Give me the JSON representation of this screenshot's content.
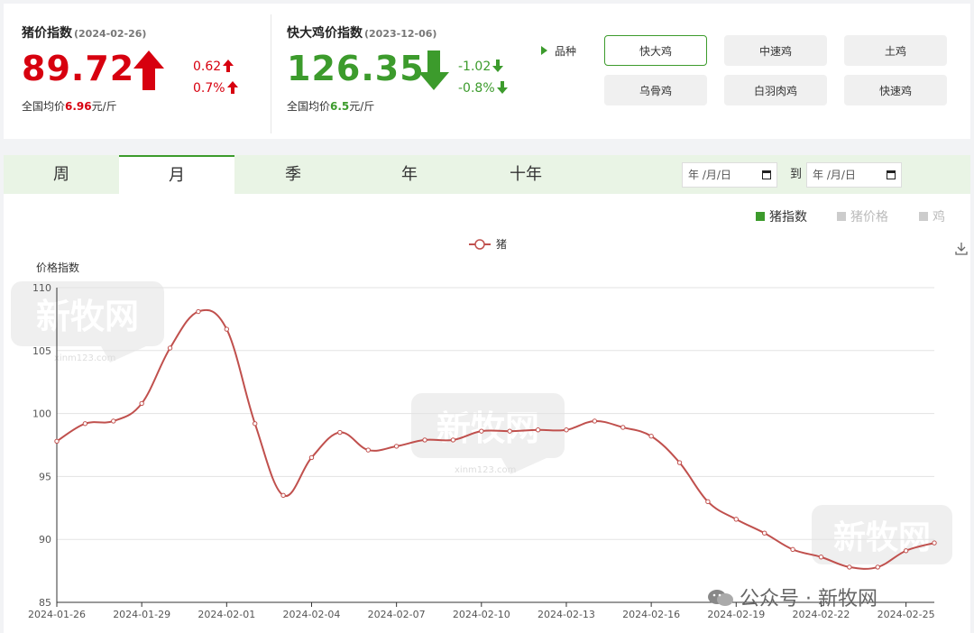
{
  "pig_index": {
    "title": "猪价指数",
    "date": "(2024-02-26)",
    "value": "89.72",
    "change_abs": "0.62",
    "change_pct": "0.7%",
    "avg_prefix": "全国均价",
    "avg_value": "6.96",
    "avg_unit": "元/斤"
  },
  "chicken_index": {
    "title": "快大鸡价指数",
    "date": "(2023-12-06)",
    "value": "126.35",
    "change_abs": "-1.02",
    "change_pct": "-0.8%",
    "avg_prefix": "全国均价",
    "avg_value": "6.5",
    "avg_unit": "元/斤"
  },
  "variety": {
    "label": "品种",
    "options": [
      "快大鸡",
      "中速鸡",
      "土鸡",
      "乌骨鸡",
      "白羽肉鸡",
      "快速鸡"
    ],
    "selected": "快大鸡"
  },
  "period_tabs": [
    "周",
    "月",
    "季",
    "年",
    "十年"
  ],
  "period_selected": "月",
  "date_range": {
    "from_placeholder": "年 /月/日",
    "to_label": "到",
    "to_placeholder": "年 /月/日"
  },
  "series_toggle": [
    {
      "label": "猪指数",
      "active": true,
      "color": "#3c9b2c"
    },
    {
      "label": "猪价格",
      "active": false,
      "color": "#cccccc"
    },
    {
      "label": "鸡",
      "active": false,
      "color": "#cccccc"
    }
  ],
  "watermark": {
    "brand": "新牧网",
    "url": "xinm123.com",
    "footer": "公众号 · 新牧网"
  },
  "icons": {
    "download": "download-icon",
    "wechat": "wechat-icon",
    "up": "arrow-up-icon",
    "down": "arrow-down-icon"
  },
  "colors": {
    "up": "#d7000f",
    "down": "#3c9b2c",
    "line": "#c0504d",
    "accent": "#3c9b2c"
  },
  "chart_data": {
    "type": "line",
    "ylabel": "价格指数",
    "ylim": [
      85,
      110
    ],
    "yticks": [
      85,
      90,
      95,
      100,
      105,
      110
    ],
    "grid": true,
    "legend": "top-center",
    "x_ticks": [
      "2024-01-26",
      "2024-01-29",
      "2024-02-01",
      "2024-02-04",
      "2024-02-07",
      "2024-02-10",
      "2024-02-13",
      "2024-02-16",
      "2024-02-19",
      "2024-02-22",
      "2024-02-25"
    ],
    "series": [
      {
        "name": "猪",
        "x": [
          "2024-01-26",
          "2024-01-27",
          "2024-01-28",
          "2024-01-29",
          "2024-01-30",
          "2024-01-31",
          "2024-02-01",
          "2024-02-02",
          "2024-02-03",
          "2024-02-04",
          "2024-02-05",
          "2024-02-06",
          "2024-02-07",
          "2024-02-08",
          "2024-02-09",
          "2024-02-10",
          "2024-02-11",
          "2024-02-12",
          "2024-02-13",
          "2024-02-14",
          "2024-02-15",
          "2024-02-16",
          "2024-02-17",
          "2024-02-18",
          "2024-02-19",
          "2024-02-20",
          "2024-02-21",
          "2024-02-22",
          "2024-02-23",
          "2024-02-24",
          "2024-02-25",
          "2024-02-26"
        ],
        "values": [
          97.8,
          99.2,
          99.4,
          100.8,
          105.2,
          108.1,
          106.7,
          99.2,
          93.5,
          96.5,
          98.5,
          97.1,
          97.4,
          97.9,
          97.9,
          98.6,
          98.6,
          98.7,
          98.7,
          99.4,
          98.9,
          98.2,
          96.1,
          93.0,
          91.6,
          90.5,
          89.2,
          88.6,
          87.8,
          87.8,
          89.1,
          89.72
        ]
      }
    ]
  }
}
